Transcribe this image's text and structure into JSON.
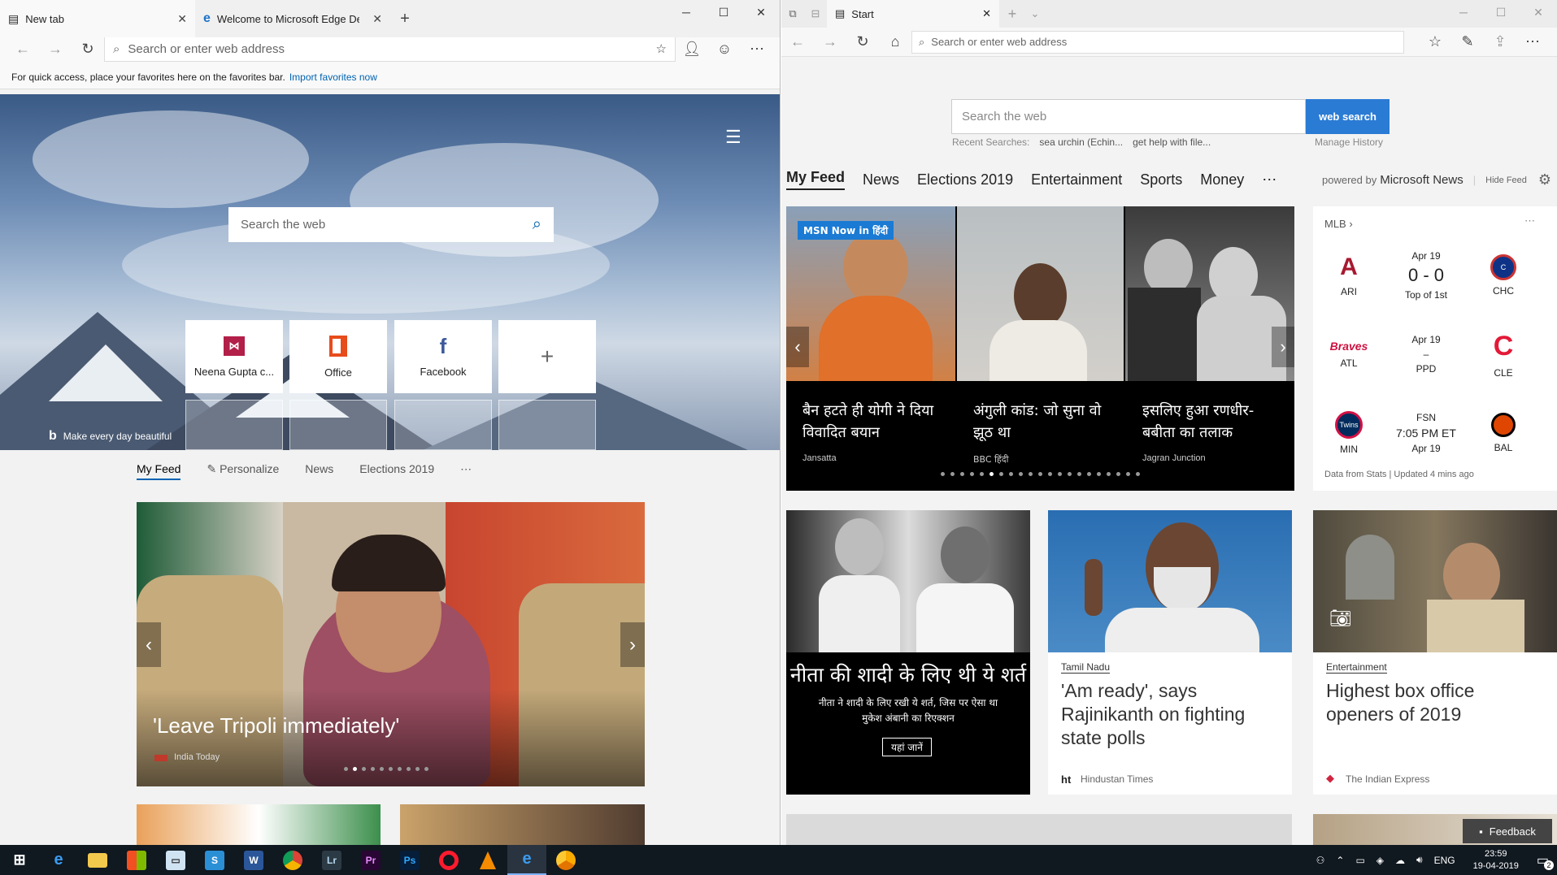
{
  "left_window": {
    "tabs": [
      {
        "title": "New tab"
      },
      {
        "title": "Welcome to Microsoft Edge Dev"
      }
    ],
    "address_placeholder": "Search or enter web address",
    "favorites_bar": {
      "text": "For quick access, place your favorites here on the favorites bar.",
      "link": "Import favorites now"
    },
    "search_placeholder": "Search the web",
    "tiles": [
      {
        "label": "Neena Gupta c...",
        "icon": "neena-gupta-site-icon"
      },
      {
        "label": "Office",
        "icon": "office-icon"
      },
      {
        "label": "Facebook",
        "icon": "facebook-icon"
      },
      {
        "label": "",
        "icon": "add-icon"
      }
    ],
    "bing_tagline": "Make every day beautiful",
    "feed_tabs": [
      "My Feed",
      "Personalize",
      "News",
      "Elections 2019"
    ],
    "hero_story": {
      "title": "'Leave Tripoli immediately'",
      "source": "India Today"
    }
  },
  "right_window": {
    "tab_title": "Start",
    "address_placeholder": "Search or enter web address",
    "search_placeholder": "Search the web",
    "search_button": "web search",
    "recent_label": "Recent Searches:",
    "recent_items": [
      "sea urchin (Echin...",
      "get help with file..."
    ],
    "manage_history": "Manage History",
    "feed_tabs": [
      "My Feed",
      "News",
      "Elections 2019",
      "Entertainment",
      "Sports",
      "Money"
    ],
    "powered_by": "powered by",
    "powered_brand": "Microsoft News",
    "hide_feed": "Hide Feed",
    "carousel_badge": "MSN Now in हिंदी",
    "carousel": [
      {
        "title": "बैन हटते ही योगी ने दिया विवादित बयान",
        "source": "Jansatta"
      },
      {
        "title": "अंगुली कांड: जो सुना वो झूठ था",
        "source": "BBC हिंदी"
      },
      {
        "title": "इसलिए हुआ रणधीर-बबीता का तलाक",
        "source": "Jagran Junction"
      }
    ],
    "mlb": {
      "header": "MLB",
      "games": [
        {
          "away": "ARI",
          "home": "CHC",
          "line1": "Apr 19",
          "line2": "0 - 0",
          "line3": "Top of 1st"
        },
        {
          "away": "ATL",
          "home": "CLE",
          "line1": "Apr 19",
          "line2": "–",
          "line3": "PPD"
        },
        {
          "away": "MIN",
          "home": "BAL",
          "line1": "FSN",
          "line2": "7:05 PM ET",
          "line3": "Apr 19"
        }
      ],
      "footer": "Data from Stats | Updated 4 mins ago"
    },
    "cards": [
      {
        "headline": "नीता की शादी के लिए थी ये शर्त",
        "sub": "नीता ने शादी के लिए रखी ये शर्त, जिस पर ऐसा था मुकेश अंबानी का रिएक्शन",
        "button": "यहां जानें"
      },
      {
        "category": "Tamil Nadu",
        "headline": "'Am ready', says Rajinikanth on fighting state polls",
        "source_logo": "ht",
        "source": "Hindustan Times"
      },
      {
        "category": "Entertainment",
        "headline": "Highest box office openers of 2019",
        "source": "The Indian Express"
      }
    ],
    "feedback": "Feedback"
  },
  "taskbar": {
    "language": "ENG",
    "time": "23:59",
    "date": "19-04-2019",
    "notifications": "2",
    "apps": [
      "windows-start",
      "edge",
      "file-explorer",
      "store",
      "notes",
      "skype",
      "word",
      "chrome",
      "lightroom",
      "premiere",
      "photoshop",
      "opera",
      "vlc",
      "edge-dev",
      "chrome-canary"
    ]
  },
  "colors": {
    "accent": "#0063b1",
    "search_button": "#2a7bd4",
    "taskbar": "#101820"
  }
}
